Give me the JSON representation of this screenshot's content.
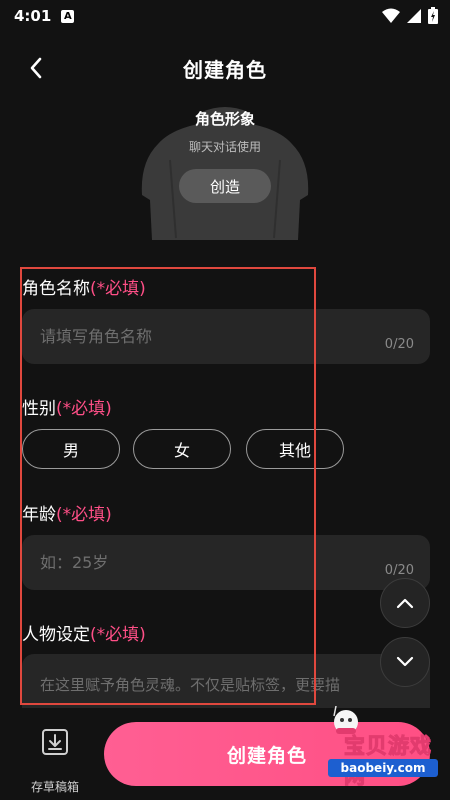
{
  "status": {
    "time": "4:01",
    "notification_letter": "A"
  },
  "header": {
    "title": "创建角色"
  },
  "avatar": {
    "title": "角色形象",
    "subtitle": "聊天对话使用",
    "create_label": "创造"
  },
  "form": {
    "required_tag": "(*必填)",
    "name": {
      "label": "角色名称",
      "placeholder": "请填写角色名称",
      "counter": "0/20"
    },
    "gender": {
      "label": "性别",
      "options": [
        "男",
        "女",
        "其他"
      ]
    },
    "age": {
      "label": "年龄",
      "placeholder": "如：25岁",
      "counter": "0/20"
    },
    "persona": {
      "label": "人物设定",
      "placeholder": "在这里赋予角色灵魂。不仅是贴标签，更要描"
    }
  },
  "bottom": {
    "draft_label": "存草稿箱",
    "create_label": "创建角色"
  },
  "watermark": {
    "text": "宝贝游戏网",
    "url": "baobeiy.com"
  },
  "colors": {
    "accent": "#ff5a8c",
    "required": "#ff4f87",
    "annotation": "#e0483e",
    "background": "#121212"
  }
}
